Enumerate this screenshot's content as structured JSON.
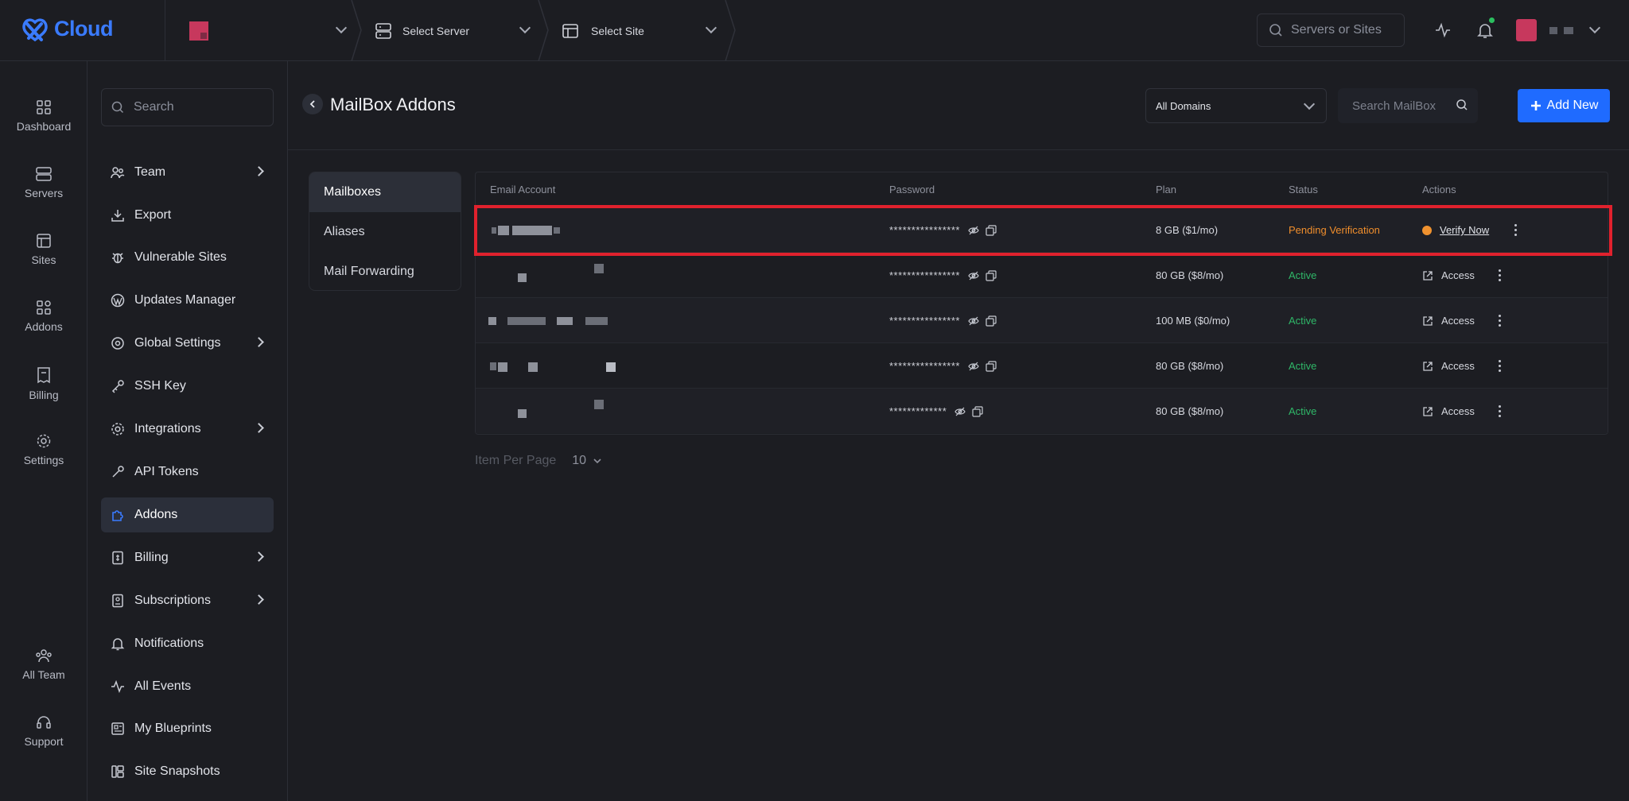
{
  "app": {
    "logo_text": "Cloud"
  },
  "topbar": {
    "server_select": "Select Server",
    "site_select": "Select Site",
    "search_placeholder": "Servers or Sites"
  },
  "rail": {
    "items": [
      {
        "label": "Dashboard",
        "icon": "grid-icon"
      },
      {
        "label": "Servers",
        "icon": "server-icon"
      },
      {
        "label": "Sites",
        "icon": "layout-icon"
      },
      {
        "label": "Addons",
        "icon": "addons-icon"
      },
      {
        "label": "Billing",
        "icon": "receipt-icon"
      },
      {
        "label": "Settings",
        "icon": "gear-icon"
      },
      {
        "label": "All Team",
        "icon": "team-icon"
      },
      {
        "label": "Support",
        "icon": "headset-icon"
      }
    ]
  },
  "nav": {
    "search_placeholder": "Search",
    "items": [
      {
        "label": "Team",
        "icon": "users-icon",
        "expandable": true
      },
      {
        "label": "Export",
        "icon": "download-icon",
        "expandable": false
      },
      {
        "label": "Vulnerable Sites",
        "icon": "bug-icon",
        "expandable": false
      },
      {
        "label": "Updates Manager",
        "icon": "wordpress-icon",
        "expandable": false
      },
      {
        "label": "Global Settings",
        "icon": "globe-gear-icon",
        "expandable": true
      },
      {
        "label": "SSH Key",
        "icon": "key-icon",
        "expandable": false
      },
      {
        "label": "Integrations",
        "icon": "gear-icon",
        "expandable": true
      },
      {
        "label": "API Tokens",
        "icon": "token-icon",
        "expandable": false
      },
      {
        "label": "Addons",
        "icon": "puzzle-icon",
        "expandable": false,
        "active": true
      },
      {
        "label": "Billing",
        "icon": "bill-icon",
        "expandable": true
      },
      {
        "label": "Subscriptions",
        "icon": "subscription-icon",
        "expandable": true
      },
      {
        "label": "Notifications",
        "icon": "bell-icon",
        "expandable": false
      },
      {
        "label": "All Events",
        "icon": "activity-icon",
        "expandable": false
      },
      {
        "label": "My Blueprints",
        "icon": "blueprint-icon",
        "expandable": false
      },
      {
        "label": "Site Snapshots",
        "icon": "snapshot-icon",
        "expandable": false
      }
    ]
  },
  "page": {
    "title": "MailBox Addons",
    "domain_filter": "All Domains",
    "search_placeholder": "Search MailBox",
    "add_new_label": "Add New"
  },
  "subtabs": [
    "Mailboxes",
    "Aliases",
    "Mail Forwarding"
  ],
  "table": {
    "headers": [
      "Email Account",
      "Password",
      "Plan",
      "Status",
      "Actions"
    ],
    "rows": [
      {
        "password": "****************",
        "plan": "8 GB ($1/mo)",
        "status": "Pending Verification",
        "action": "Verify Now"
      },
      {
        "password": "****************",
        "plan": "80 GB ($8/mo)",
        "status": "Active",
        "action": "Access"
      },
      {
        "password": "****************",
        "plan": "100 MB ($0/mo)",
        "status": "Active",
        "action": "Access"
      },
      {
        "password": "****************",
        "plan": "80 GB ($8/mo)",
        "status": "Active",
        "action": "Access"
      },
      {
        "password": "*************",
        "plan": "80 GB ($8/mo)",
        "status": "Active",
        "action": "Access"
      }
    ]
  },
  "pager": {
    "label": "Item Per Page",
    "value": "10"
  },
  "colors": {
    "accent": "#1f6bff",
    "active": "#2fb768",
    "pending": "#f08e2c",
    "highlight": "#e0212d"
  }
}
